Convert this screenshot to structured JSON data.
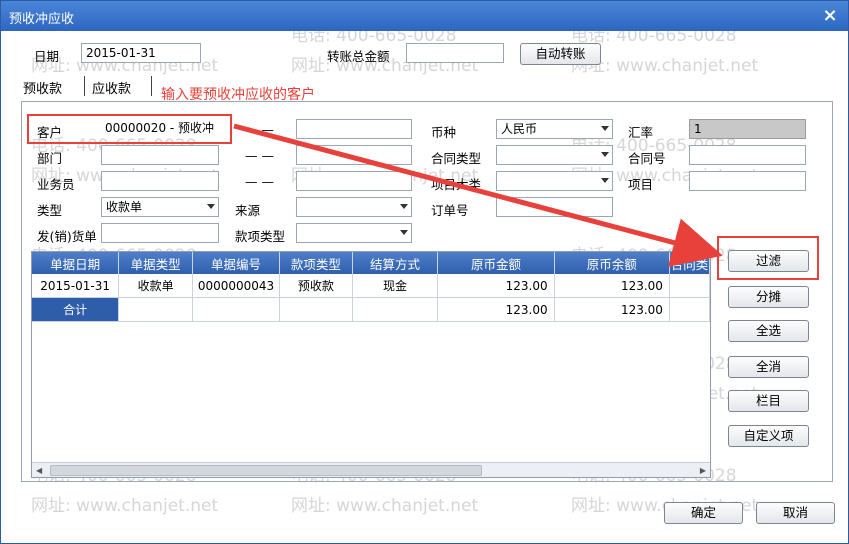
{
  "window": {
    "title": "预收冲应收",
    "close": "×"
  },
  "date": {
    "label": "日期",
    "value": "2015-01-31"
  },
  "transfer_total": {
    "label": "转账总金额",
    "value": ""
  },
  "auto_transfer_label": "自动转账",
  "tabs": [
    {
      "label": "预收款"
    },
    {
      "label": "应收款"
    }
  ],
  "annotation": "输入要预收冲应收的客户",
  "form": {
    "customer_label": "客户",
    "customer_value": "00000020 - 预收冲",
    "dash": "— —",
    "currency_label": "币种",
    "currency_value": "人民币",
    "rate_label": "汇率",
    "rate_value": "1",
    "dept_label": "部门",
    "contract_type_label": "合同类型",
    "contract_no_label": "合同号",
    "staff_label": "业务员",
    "project_cat_label": "项目大类",
    "project_label": "项目",
    "type_label": "类型",
    "type_value": "收款单",
    "source_label": "来源",
    "order_label": "订单号",
    "ship_label": "发(销)货单",
    "fund_type_label": "款项类型"
  },
  "table": {
    "headers": [
      "单据日期",
      "单据类型",
      "单据编号",
      "款项类型",
      "结算方式",
      "原币金额",
      "原币余额",
      "合同类"
    ],
    "rows": [
      [
        "2015-01-31",
        "收款单",
        "0000000043",
        "预收款",
        "现金",
        "123.00",
        "123.00",
        ""
      ]
    ],
    "total": {
      "label": "合计",
      "amount": "123.00",
      "balance": "123.00"
    }
  },
  "side_buttons": {
    "filter": "过滤",
    "allocate": "分摊",
    "select_all": "全选",
    "deselect_all": "全消",
    "columns": "栏目",
    "custom": "自定义项"
  },
  "footer": {
    "ok": "确定",
    "cancel": "取消"
  },
  "watermark": {
    "phone": "电话: 400-665-0028",
    "site": "网址: www.chanjet.net"
  },
  "colors": {
    "accent": "#2e5daa",
    "annotation": "#e8403a"
  }
}
